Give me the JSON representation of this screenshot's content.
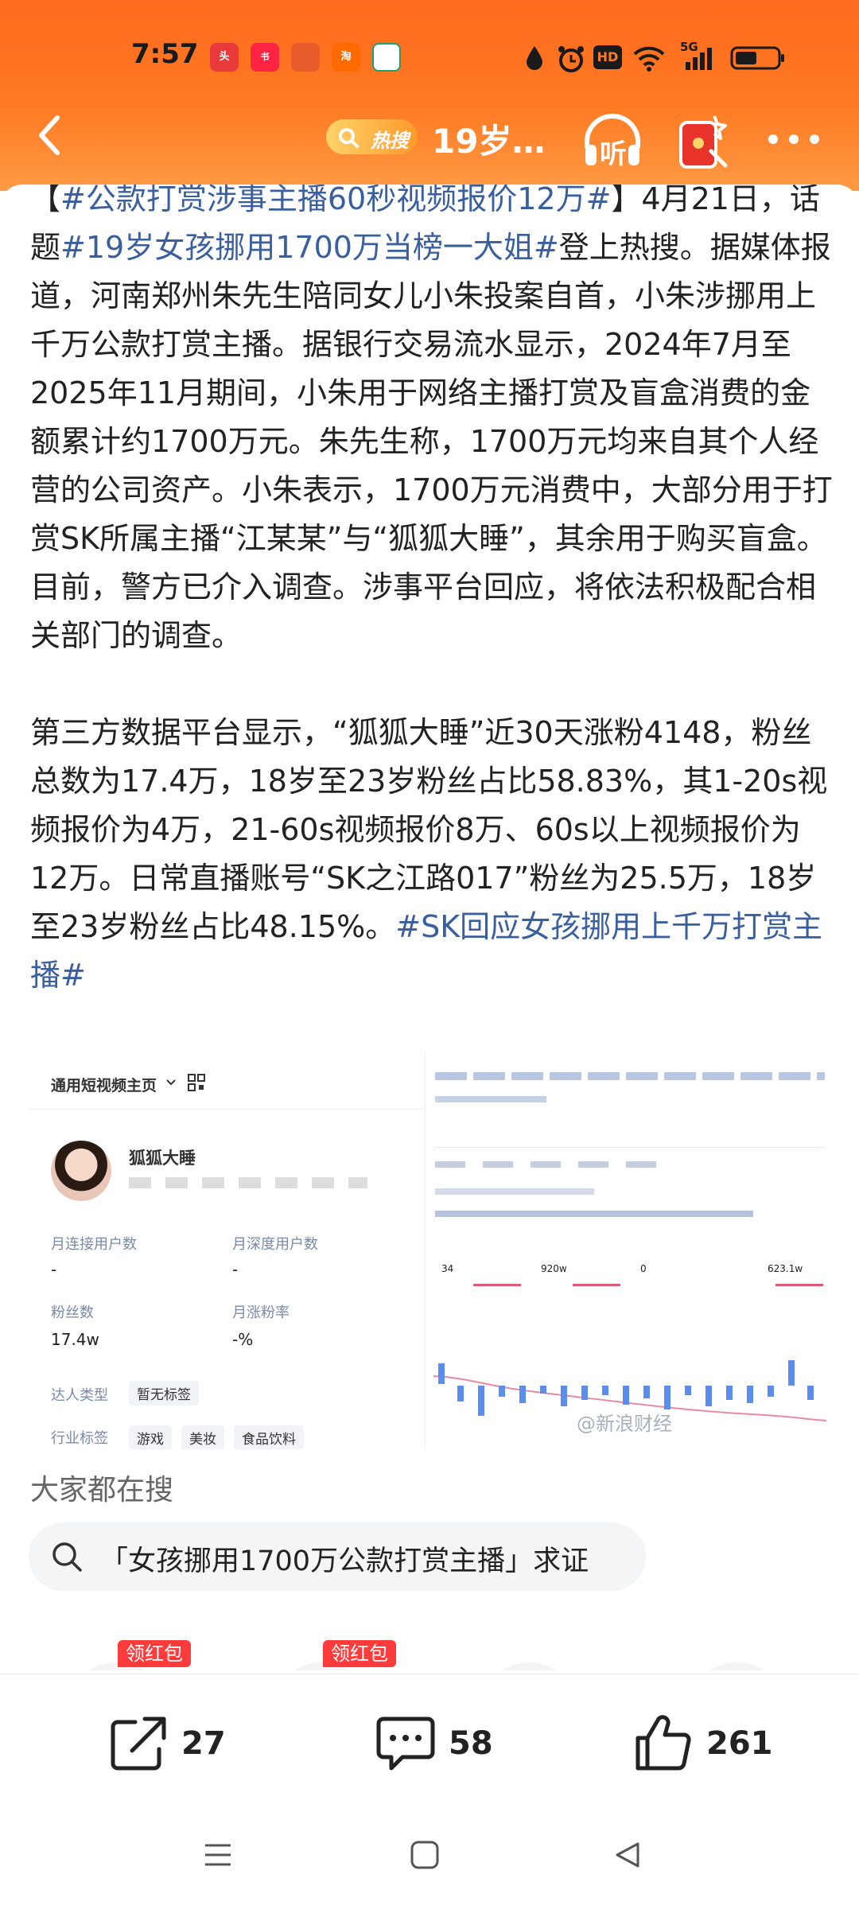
{
  "status_bar": {
    "time": "7:57",
    "apps": [
      {
        "name": "toutiao",
        "text": "头条",
        "color": "#e83a3a"
      },
      {
        "name": "xiaohongshu",
        "text": "小红书",
        "color": "#ff2442"
      },
      {
        "name": "app3",
        "text": "",
        "color": "#e85a2a"
      },
      {
        "name": "taobao",
        "text": "淘",
        "color": "#ff6a00"
      },
      {
        "name": "bank",
        "text": "",
        "color": "#1e9e6a"
      }
    ],
    "network": "5G",
    "hd": "HD"
  },
  "nav": {
    "hot_label": "热搜",
    "title": "19岁…",
    "listen_label": "听"
  },
  "article": {
    "p1_pre": "【",
    "p1_tag1": "#公款打赏涉事主播60秒视频报价12万#",
    "p1_mid1": "】4月21日，话题",
    "p1_tag2": "#19岁女孩挪用1700万当榜一大姐#",
    "p1_rest": "登上热搜。据媒体报道，河南郑州朱先生陪同女儿小朱投案自首，小朱涉挪用上千万公款打赏主播。据银行交易流水显示，2024年7月至2025年11月期间，小朱用于网络主播打赏及盲盒消费的金额累计约1700万元。朱先生称，1700万元均来自其个人经营的公司资产。小朱表示，1700万元消费中，大部分用于打赏SK所属主播“江某某”与“狐狐大睡”，其余用于购买盲盒。目前，警方已介入调查。涉事平台回应，将依法积极配合相关部门的调查。",
    "p2_text": "第三方数据平台显示，“狐狐大睡”近30天涨粉4148，粉丝总数为17.4万，18岁至23岁粉丝占比58.83%，其1-20s视频报价为4万，21-60s视频报价8万、60s以上视频报价为12万。日常直播账号“SK之江路017”粉丝为25.5万，18岁至23岁粉丝占比48.15%。",
    "p2_tag": "#SK回应女孩挪用上千万打赏主播#"
  },
  "image_left": {
    "dropdown": "通用短视频主页",
    "name": "狐狐大睡",
    "stat1_label": "月连接用户数",
    "stat1_value": "-",
    "stat2_label": "月深度用户数",
    "stat2_value": "-",
    "stat3_label": "粉丝数",
    "stat3_value": "17.4w",
    "stat4_label": "月涨粉率",
    "stat4_value": "-%",
    "tag_label": "达人类型",
    "tag_value": "暂无标签",
    "row_label": "行业标签",
    "row_values": [
      "游戏",
      "美妆",
      "食品饮料"
    ]
  },
  "image_right": {
    "kpi_values": [
      "34",
      "920w",
      "0",
      "623.1w"
    ],
    "watermark": "@新浪财经"
  },
  "search": {
    "section_title": "大家都在搜",
    "query": "「女孩挪用1700万公款打赏主播」求证"
  },
  "promo": {
    "badge1": "领红包",
    "badge2": "领红包"
  },
  "actions": {
    "share_count": "27",
    "comment_count": "58",
    "like_count": "261"
  },
  "colors": {
    "header": "#ff7a22",
    "topic_link": "#3a5f9e",
    "badge_red": "#ff3b3b"
  }
}
